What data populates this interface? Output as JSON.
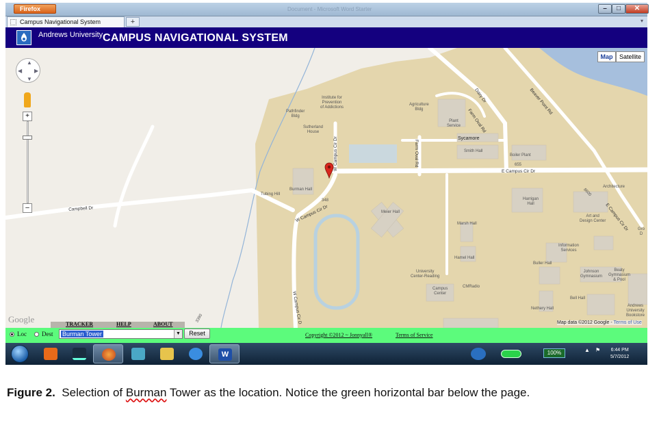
{
  "browser": {
    "menu_button": "Firefox",
    "ghost_title": "Document - Microsoft Word Starter",
    "tab_title": "Campus Navigational System",
    "new_tab": "+",
    "tab_dropdown": "▾"
  },
  "window_controls": {
    "minimize": "–",
    "maximize": "□",
    "close": "✕"
  },
  "header": {
    "university": "Andrews University",
    "system_title": "CAMPUS NAVIGATIONAL SYSTEM"
  },
  "map": {
    "type_map": "Map",
    "type_satellite": "Satellite",
    "zoom_in": "+",
    "zoom_out": "–",
    "google_logo": "Google",
    "map_data": "Map data ©2012 Google - ",
    "terms_of_use": "Terms of Use",
    "menu": {
      "tracker": "TRACKER",
      "help": "HELP",
      "about": "ABOUT"
    },
    "labels": {
      "institute": "Institute for\nPrevention\nof Addictions",
      "pathfinder": "Pathfinder\nBldg",
      "sutherland": "Sutherland\nHouse",
      "agriculture": "Agriculture\nBldg",
      "plant_service": "Plant\nService",
      "sycamore": "Sycamore",
      "smith_hall": "Smith Hall",
      "boiler_plant": "Boiler Plant",
      "burman_hall": "Burman Hall",
      "tubing_hill": "Tubing Hill",
      "meier_hall": "Meier Hall",
      "harrigan_hall": "Harrigan\nHall",
      "architecture": "Architecture",
      "art_design": "Art and\nDesign Center",
      "marsh_hall": "Marsh Hall",
      "information_services": "Information\nServices",
      "buller_hall": "Buller Hall",
      "hamel_hall": "Hamel Hall",
      "johnson_gym": "Johnson\nGymnasium",
      "beaty_gym": "Beaty\nGymnasium\n& Pool",
      "university_center": "University\nCenter-Reading",
      "campus_center": "Campus\nCenter",
      "cmradio": "CMRadio",
      "bell_hall": "Bell Hall",
      "nethery_hall": "Nethery Hall",
      "andrews_bookstore": "Andrews\nUniversity\nBookstore",
      "gro": "Gro\nD",
      "addr_655": "655",
      "addr_348": "348",
      "addr_8600": "8600",
      "addr_3390": "3390"
    },
    "roads": {
      "campbell": "Campbell Dr",
      "w_campus_cir_v": "W Campus Cir Dr",
      "w_campus_cir_d": "W Campus Cir Dr",
      "w_campus_cir_s": "W Campus Cir D",
      "e_campus_cir": "E Campus Cir Dr",
      "farm_oval_v": "Farm Oval Rd",
      "farm_oval_d": "Farm Oval Rd",
      "dairy": "Dairy Dr",
      "beaver_point": "Beaver Point Rd",
      "e_campus_cir_d": "E Campus Cir Dr"
    }
  },
  "controls": {
    "loc_label": "Loc",
    "dest_label": "Dest",
    "loc_selected": true,
    "selected_location": "Burman Tower",
    "reset_label": "Reset",
    "copyright": "Copyright ©2012 ~ Jonnyall®",
    "terms": "Terms of Service"
  },
  "taskbar": {
    "battery_percent": "100%",
    "clock_time": "6:44 PM",
    "clock_date": "5/7/2012",
    "tray_up": "▲"
  },
  "caption": {
    "fig": "Figure 2.",
    "text_pre": "  Selection of ",
    "text_word": "Burman",
    "text_post": " Tower as the location. Notice the green horizontal bar below the page."
  },
  "colors": {
    "header": "#14007f",
    "greenbar": "#5cfb7c",
    "campus_land": "#e4d6ad",
    "water": "#a6bfdd",
    "road": "#ffffff",
    "building": "#d7d1c4"
  }
}
